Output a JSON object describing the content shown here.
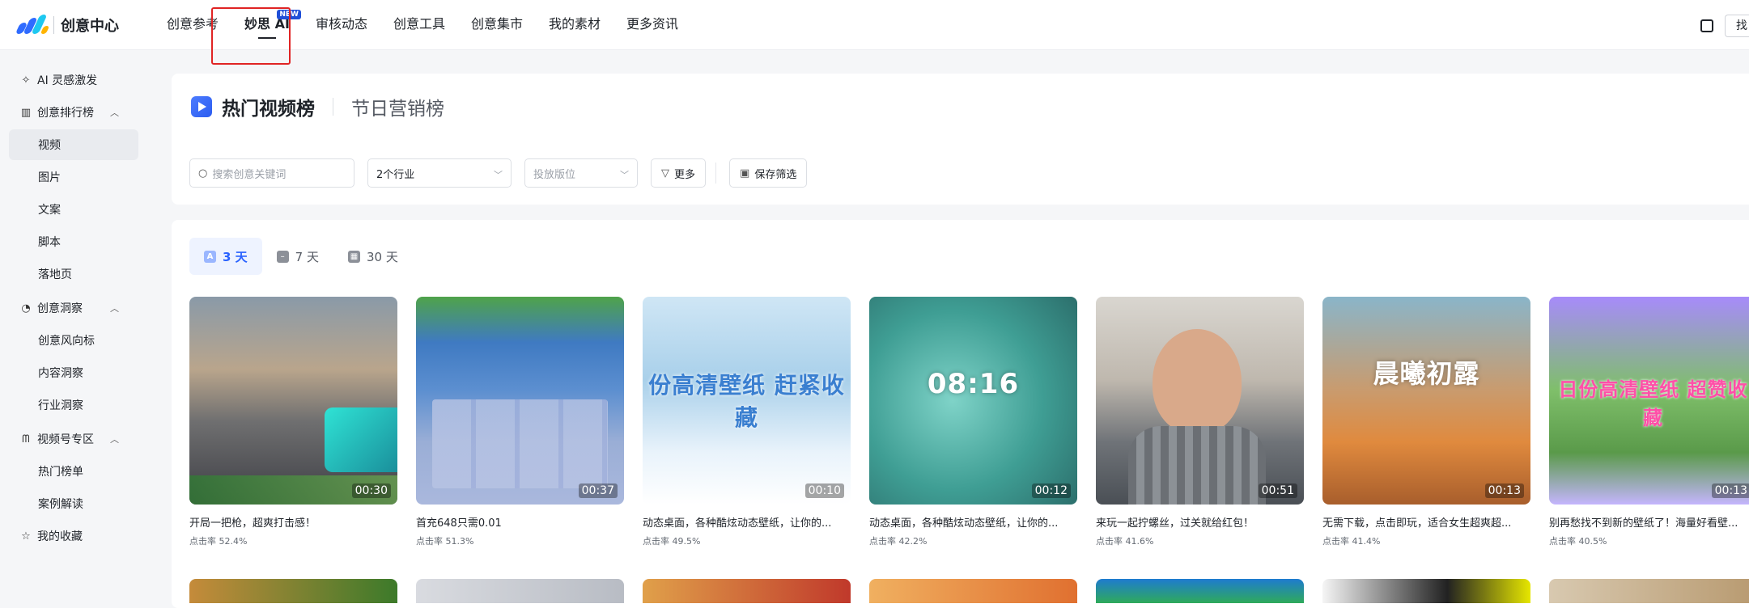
{
  "app": {
    "title": "创意中心",
    "colors": {
      "accent": "#2962ff",
      "highlight": "#e02424",
      "logo": [
        "#2f6bff",
        "#1ec8f0",
        "#ffb400"
      ]
    }
  },
  "nav": {
    "items": [
      {
        "label": "创意参考",
        "active": false
      },
      {
        "label": "妙思 AI",
        "active": true,
        "badge": "NEW"
      },
      {
        "label": "审核动态",
        "active": false
      },
      {
        "label": "创意工具",
        "active": false
      },
      {
        "label": "创意集市",
        "active": false
      },
      {
        "label": "我的素材",
        "active": false
      },
      {
        "label": "更多资讯",
        "active": false
      }
    ],
    "right_button_label": "找"
  },
  "sidebar": {
    "items": [
      {
        "label": "AI 灵感激发",
        "icon": "sparkle-icon",
        "level": 1
      },
      {
        "label": "创意排行榜",
        "icon": "bar-chart-icon",
        "level": 1,
        "expanded": true
      },
      {
        "label": "视频",
        "level": 2,
        "active": true
      },
      {
        "label": "图片",
        "level": 2
      },
      {
        "label": "文案",
        "level": 2
      },
      {
        "label": "脚本",
        "level": 2
      },
      {
        "label": "落地页",
        "level": 2
      },
      {
        "label": "创意洞察",
        "icon": "compass-icon",
        "level": 1,
        "expanded": true
      },
      {
        "label": "创意风向标",
        "level": 2
      },
      {
        "label": "内容洞察",
        "level": 2
      },
      {
        "label": "行业洞察",
        "level": 2
      },
      {
        "label": "视频号专区",
        "icon": "channels-icon",
        "level": 1,
        "expanded": true
      },
      {
        "label": "热门榜单",
        "level": 2
      },
      {
        "label": "案例解读",
        "level": 2
      },
      {
        "label": "我的收藏",
        "icon": "star-icon",
        "level": 1
      }
    ]
  },
  "ranking": {
    "title": "热门视频榜",
    "secondary_tab": "节日营销榜"
  },
  "filters": {
    "search_placeholder": "搜索创意关键词",
    "industry_value": "2个行业",
    "position_placeholder": "投放版位",
    "more_label": "更多",
    "save_label": "保存筛选"
  },
  "ranges": [
    {
      "label": "3 天",
      "active": true
    },
    {
      "label": "7 天",
      "active": false
    },
    {
      "label": "30 天",
      "active": false
    }
  ],
  "videos": [
    {
      "title": "开局一把枪，超爽打击感！",
      "ctr": "点击率 52.4%",
      "duration": "00:30",
      "overlay": ""
    },
    {
      "title": "首充648只需0.01",
      "ctr": "点击率 51.3%",
      "duration": "00:37",
      "overlay": ""
    },
    {
      "title": "动态桌面，各种酷炫动态壁纸，让你的...",
      "ctr": "点击率 49.5%",
      "duration": "00:10",
      "overlay": "份高清壁纸 赶紧收藏"
    },
    {
      "title": "动态桌面，各种酷炫动态壁纸，让你的...",
      "ctr": "点击率 42.2%",
      "duration": "00:12",
      "overlay": "08:16"
    },
    {
      "title": "来玩一起拧螺丝，过关就给红包！",
      "ctr": "点击率 41.6%",
      "duration": "00:51",
      "overlay": ""
    },
    {
      "title": "无需下载，点击即玩，适合女生超爽超...",
      "ctr": "点击率 41.4%",
      "duration": "00:13",
      "overlay": "晨曦初露"
    },
    {
      "title": "别再愁找不到新的壁纸了！海量好看壁...",
      "ctr": "点击率 40.5%",
      "duration": "00:13",
      "overlay": "日份高清壁纸 超赞收藏"
    }
  ]
}
